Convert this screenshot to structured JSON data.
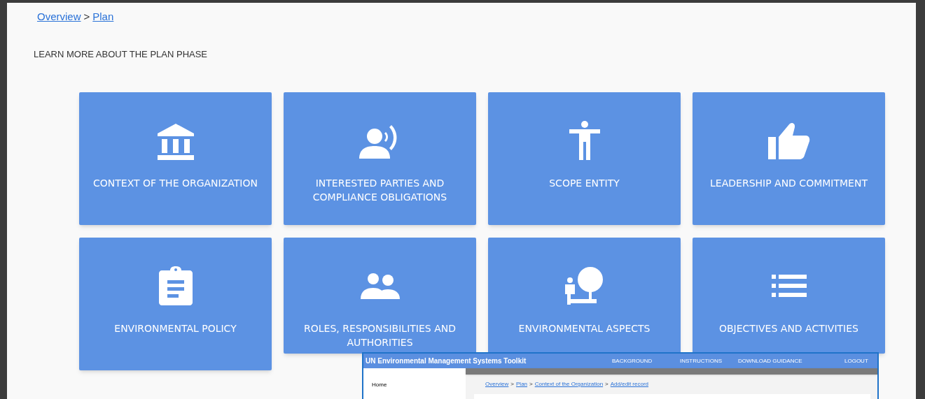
{
  "breadcrumb": [
    {
      "label": "Overview"
    },
    {
      "label": "Plan"
    }
  ],
  "breadcrumb_separator": ">",
  "heading": "LEARN MORE ABOUT THE PLAN PHASE",
  "cards": [
    {
      "kind": "building",
      "label": "CONTEXT OF THE ORGANIZATION"
    },
    {
      "kind": "speaker",
      "label": "INTERESTED PARTIES AND COMPLIANCE OBLIGATIONS"
    },
    {
      "kind": "figure",
      "label": "SCOPE ENTITY"
    },
    {
      "kind": "thumb",
      "label": "LEADERSHIP AND COMMITMENT"
    },
    {
      "kind": "clipboard",
      "label": "ENVIRONMENTAL POLICY"
    },
    {
      "kind": "people",
      "label": "ROLES, RESPONSIBILITIES AND AUTHORITIES"
    },
    {
      "kind": "tree",
      "label": "ENVIRONMENTAL ASPECTS"
    },
    {
      "kind": "list",
      "label": "OBJECTIVES AND ACTIVITIES"
    }
  ],
  "preview_window": {
    "title": "UN Environmental Management Systems Toolkit",
    "nav": [
      "BACKGROUND",
      "INSTRUCTIONS",
      "DOWNLOAD GUIDANCE",
      "LOGOUT"
    ],
    "sidebar": [
      "Home"
    ],
    "breadcrumb": [
      {
        "label": "Overview"
      },
      {
        "label": "Plan"
      },
      {
        "label": "Context of the Organization"
      },
      {
        "label": "Add/edit record"
      }
    ],
    "breadcrumb_separator": ">"
  }
}
